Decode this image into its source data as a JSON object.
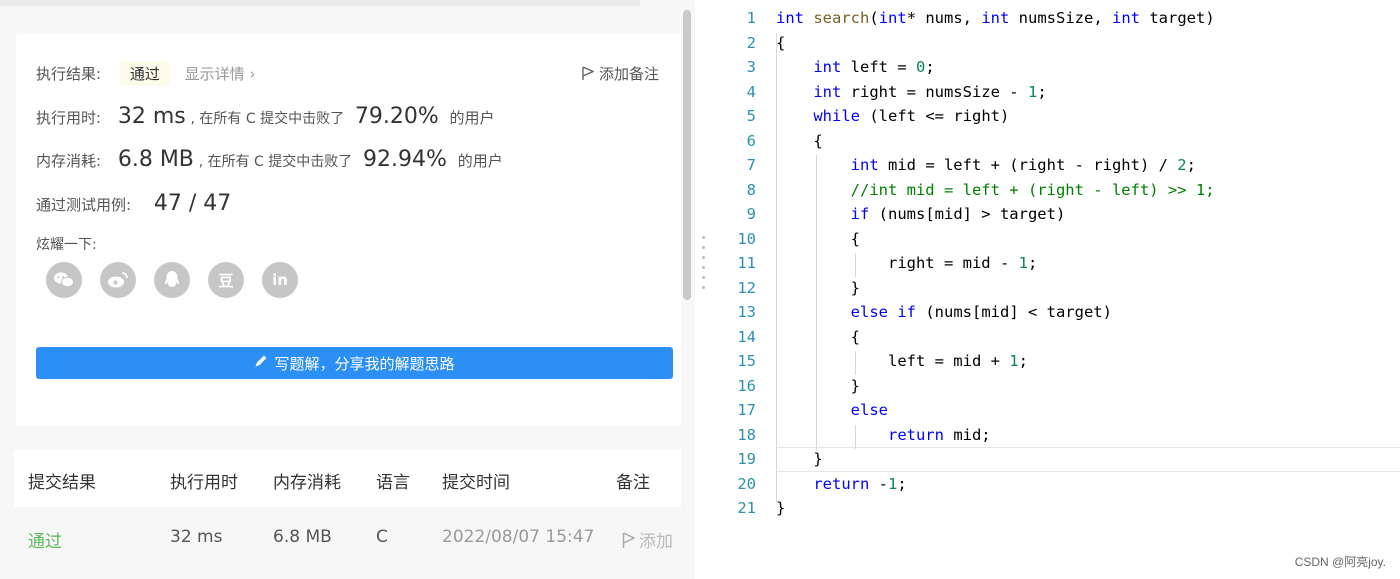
{
  "result_card": {
    "result_label": "执行结果:",
    "result_value": "通过",
    "detail_link": "显示详情",
    "add_note": "添加备注",
    "time_label": "执行用时:",
    "time_value": "32 ms",
    "time_mid": ", 在所有 C 提交中击败了",
    "time_percent": "79.20%",
    "time_suffix": "的用户",
    "memory_label": "内存消耗:",
    "memory_value": "6.8 MB",
    "memory_mid": ", 在所有 C 提交中击败了",
    "memory_percent": "92.94%",
    "memory_suffix": "的用户",
    "tests_label": "通过测试用例:",
    "tests_value": "47 / 47",
    "share_label": "炫耀一下:",
    "social_icons": [
      "wechat-icon",
      "weibo-icon",
      "qq-icon",
      "douban-icon",
      "linkedin-icon"
    ],
    "douban_glyph": "豆",
    "linkedin_glyph": "in",
    "solution_button": "写题解，分享我的解题思路"
  },
  "submissions": {
    "headers": [
      "提交结果",
      "执行用时",
      "内存消耗",
      "语言",
      "提交时间",
      "备注"
    ],
    "row": {
      "result": "通过",
      "time": "32 ms",
      "memory": "6.8 MB",
      "language": "C",
      "submitted_at": "2022/08/07 15:47",
      "note": "添加"
    }
  },
  "code_lines": [
    "int search(int* nums, int numsSize, int target)",
    "{",
    "    int left = 0;",
    "    int right = numsSize - 1;",
    "    while (left <= right)",
    "    {",
    "        int mid = left + (right - right) / 2;",
    "        //int mid = left + (right - left) >> 1;",
    "        if (nums[mid] > target)",
    "        {",
    "            right = mid - 1;",
    "        }",
    "        else if (nums[mid] < target)",
    "        {",
    "            left = mid + 1;",
    "        }",
    "        else",
    "            return mid;",
    "    }",
    "    return -1;",
    "}"
  ],
  "watermark": "CSDN @阿亮joy.",
  "colors": {
    "accent_blue": "#2b8ff6",
    "pass_green": "#5cb85c",
    "keyword": "#0000ff",
    "comment": "#008000",
    "line_number": "#2b91af"
  }
}
